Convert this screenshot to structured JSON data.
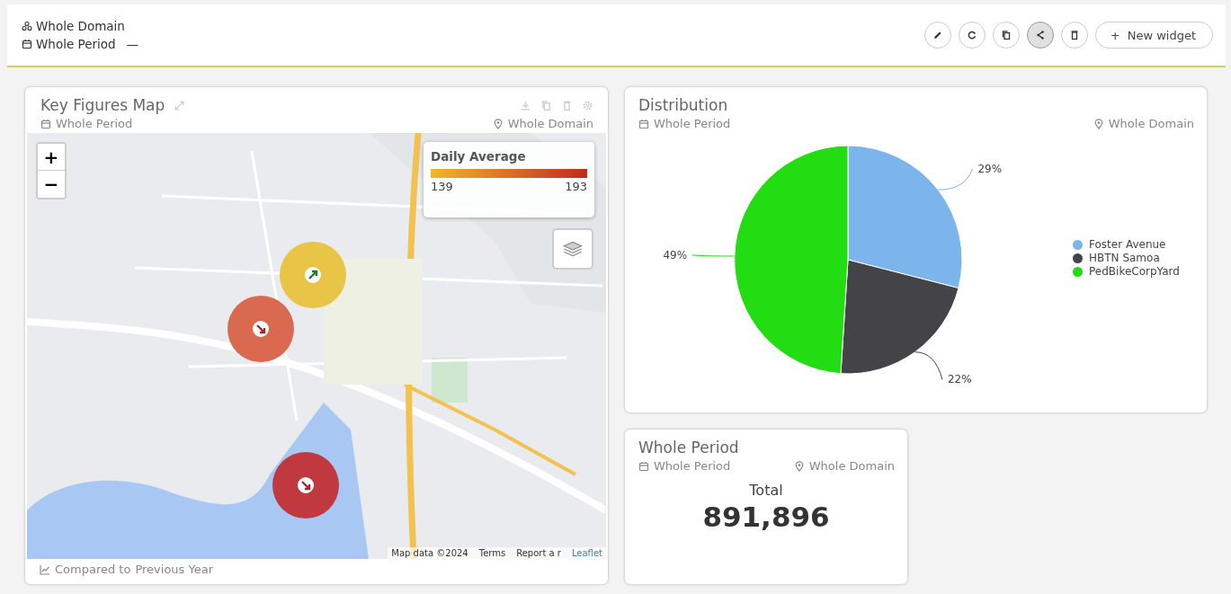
{
  "header": {
    "domain": "Whole Domain",
    "period": "Whole Period",
    "period_suffix": "—",
    "toolbar": [
      {
        "kind": "edit",
        "selected": false
      },
      {
        "kind": "refresh",
        "selected": false
      },
      {
        "kind": "copy",
        "selected": false
      },
      {
        "kind": "share",
        "selected": true
      },
      {
        "kind": "delete",
        "selected": false
      }
    ],
    "new_widget": {
      "icon": "+",
      "label": "New widget"
    }
  },
  "map_card": {
    "title": "Key Figures Map",
    "period": "Whole Period",
    "domain": "Whole Domain",
    "zoom_in": "+",
    "zoom_out": "−",
    "legend": {
      "title": "Daily Average",
      "min": "139",
      "max": "193"
    },
    "markers": [
      {
        "kind": "up",
        "color": "#e8c547"
      },
      {
        "kind": "down",
        "color": "#d9694f"
      },
      {
        "kind": "down",
        "color": "#c0393f"
      }
    ],
    "attribution": [
      "Map data ©2024",
      "Terms",
      "Report a r",
      "Leaflet"
    ],
    "footer_prefix": "Compared to",
    "footer_value": "Previous Year"
  },
  "distribution_card": {
    "title": "Distribution",
    "period": "Whole Period",
    "domain": "Whole Domain",
    "legend": [
      {
        "color": "#7cb5ec"
      },
      {
        "color": "#434348"
      },
      {
        "color": "#22dd11"
      }
    ],
    "chart_data": {
      "type": "pie",
      "categories": [
        "Foster Avenue",
        "HBTN Samoa",
        "PedBikeCorpYard"
      ],
      "values": [
        29,
        22,
        49
      ],
      "data_labels": true,
      "value_labels": [
        "29%",
        "22%",
        "49%"
      ]
    }
  },
  "total_card": {
    "title": "Whole Period",
    "period": "Whole Period",
    "domain": "Whole Domain",
    "label": "Total",
    "value": "891,896"
  }
}
